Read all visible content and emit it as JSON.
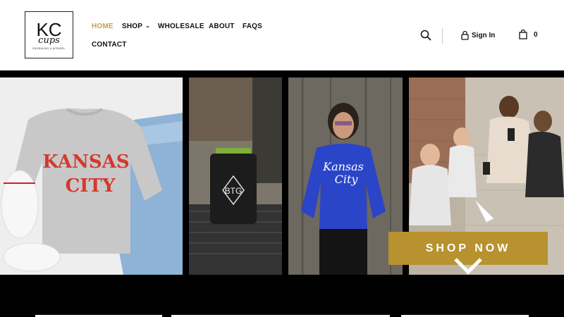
{
  "logo": {
    "kc": "KC",
    "cups": "cups",
    "tagline": "ENGRAVING & APPAREL"
  },
  "nav": {
    "items": [
      {
        "label": "HOME",
        "active": true
      },
      {
        "label": "SHOP",
        "has_dropdown": true
      },
      {
        "label": "WHOLESALE"
      },
      {
        "label": "ABOUT"
      },
      {
        "label": "FAQS"
      },
      {
        "label": "CONTACT"
      }
    ]
  },
  "header_actions": {
    "search_icon": "search-icon",
    "sign_in_label": "Sign In",
    "cart_count": "0"
  },
  "banner": {
    "panels": [
      {
        "text_line1": "KANSAS",
        "text_line2": "CITY"
      },
      {
        "text": "BTG"
      },
      {
        "text_line1": "Kansas",
        "text_line2": "City"
      },
      {}
    ],
    "cta_label": "SHOP NOW"
  },
  "colors": {
    "accent": "#c9a13b",
    "cta_bg": "#b8922f",
    "text": "#111111"
  }
}
